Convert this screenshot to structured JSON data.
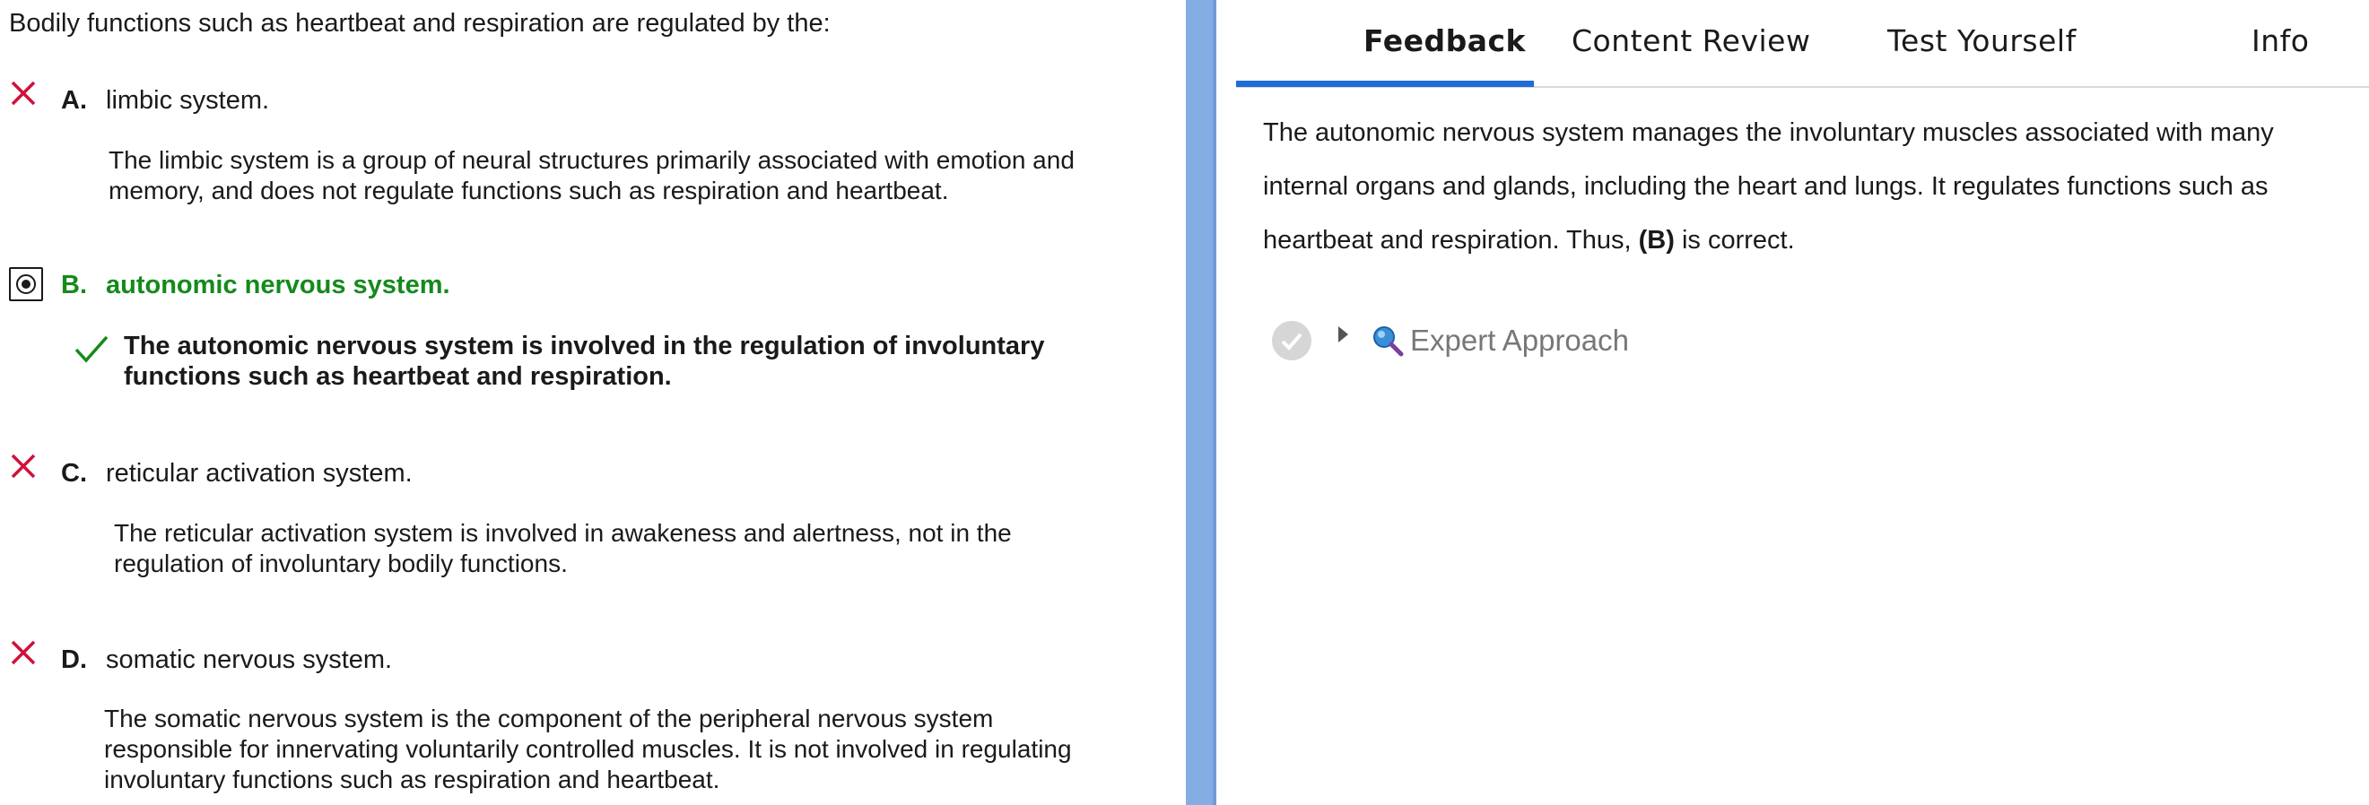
{
  "question": "Bodily functions such as heartbeat and respiration are regulated by the:",
  "choices": [
    {
      "letter": "A.",
      "text": "limbic system.",
      "status": "incorrect",
      "explanation": [
        "The limbic system is a group of neural structures primarily associated with emotion and",
        "memory, and does not regulate functions such as respiration and heartbeat."
      ]
    },
    {
      "letter": "B.",
      "text": "autonomic nervous system.",
      "status": "correct-selected",
      "explanation": [
        "The autonomic nervous system is involved in the regulation of involuntary",
        "functions such as heartbeat and respiration."
      ]
    },
    {
      "letter": "C.",
      "text": "reticular activation system.",
      "status": "incorrect",
      "explanation": [
        "The reticular activation system is involved in awakeness and alertness, not in the",
        "regulation of involuntary bodily functions."
      ]
    },
    {
      "letter": "D.",
      "text": "somatic nervous system.",
      "status": "incorrect",
      "explanation": [
        "The somatic nervous system is the component of the peripheral nervous system",
        "responsible for innervating voluntarily controlled muscles. It is not involved in regulating",
        "involuntary functions such as respiration and heartbeat."
      ]
    }
  ],
  "tabs": [
    {
      "label": "Feedback",
      "active": true
    },
    {
      "label": "Content Review",
      "active": false
    },
    {
      "label": "Test Yourself",
      "active": false
    },
    {
      "label": "Info",
      "active": false
    }
  ],
  "feedback": {
    "line1": "The autonomic nervous system manages the involuntary muscles associated with many",
    "line2": "internal organs and glands, including the heart and lungs. It regulates functions such as",
    "line3_pre": "heartbeat and respiration. Thus, ",
    "line3_bold": "(B)",
    "line3_post": " is correct."
  },
  "expert_approach": {
    "label": "Expert Approach"
  },
  "colors": {
    "correct": "#148a1c",
    "incorrect": "#d0103a",
    "accent": "#1f6bd8",
    "divider": "#84ade3"
  },
  "icons": {
    "incorrect": "x-mark-icon",
    "correct": "check-mark-icon",
    "selected": "radio-selected-icon",
    "expand": "expand-triangle-icon",
    "search": "magnifier-icon",
    "complete": "check-circle-icon"
  }
}
